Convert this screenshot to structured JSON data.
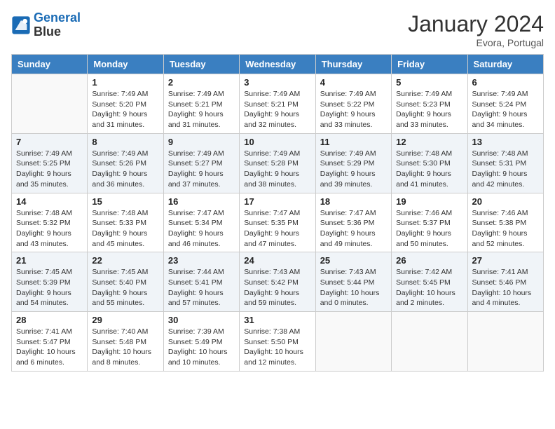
{
  "logo": {
    "line1": "General",
    "line2": "Blue"
  },
  "title": "January 2024",
  "location": "Evora, Portugal",
  "days_header": [
    "Sunday",
    "Monday",
    "Tuesday",
    "Wednesday",
    "Thursday",
    "Friday",
    "Saturday"
  ],
  "weeks": [
    [
      {
        "day": "",
        "info": ""
      },
      {
        "day": "1",
        "info": "Sunrise: 7:49 AM\nSunset: 5:20 PM\nDaylight: 9 hours and 31 minutes."
      },
      {
        "day": "2",
        "info": "Sunrise: 7:49 AM\nSunset: 5:21 PM\nDaylight: 9 hours and 31 minutes."
      },
      {
        "day": "3",
        "info": "Sunrise: 7:49 AM\nSunset: 5:21 PM\nDaylight: 9 hours and 32 minutes."
      },
      {
        "day": "4",
        "info": "Sunrise: 7:49 AM\nSunset: 5:22 PM\nDaylight: 9 hours and 33 minutes."
      },
      {
        "day": "5",
        "info": "Sunrise: 7:49 AM\nSunset: 5:23 PM\nDaylight: 9 hours and 33 minutes."
      },
      {
        "day": "6",
        "info": "Sunrise: 7:49 AM\nSunset: 5:24 PM\nDaylight: 9 hours and 34 minutes."
      }
    ],
    [
      {
        "day": "7",
        "info": "Sunrise: 7:49 AM\nSunset: 5:25 PM\nDaylight: 9 hours and 35 minutes."
      },
      {
        "day": "8",
        "info": "Sunrise: 7:49 AM\nSunset: 5:26 PM\nDaylight: 9 hours and 36 minutes."
      },
      {
        "day": "9",
        "info": "Sunrise: 7:49 AM\nSunset: 5:27 PM\nDaylight: 9 hours and 37 minutes."
      },
      {
        "day": "10",
        "info": "Sunrise: 7:49 AM\nSunset: 5:28 PM\nDaylight: 9 hours and 38 minutes."
      },
      {
        "day": "11",
        "info": "Sunrise: 7:49 AM\nSunset: 5:29 PM\nDaylight: 9 hours and 39 minutes."
      },
      {
        "day": "12",
        "info": "Sunrise: 7:48 AM\nSunset: 5:30 PM\nDaylight: 9 hours and 41 minutes."
      },
      {
        "day": "13",
        "info": "Sunrise: 7:48 AM\nSunset: 5:31 PM\nDaylight: 9 hours and 42 minutes."
      }
    ],
    [
      {
        "day": "14",
        "info": "Sunrise: 7:48 AM\nSunset: 5:32 PM\nDaylight: 9 hours and 43 minutes."
      },
      {
        "day": "15",
        "info": "Sunrise: 7:48 AM\nSunset: 5:33 PM\nDaylight: 9 hours and 45 minutes."
      },
      {
        "day": "16",
        "info": "Sunrise: 7:47 AM\nSunset: 5:34 PM\nDaylight: 9 hours and 46 minutes."
      },
      {
        "day": "17",
        "info": "Sunrise: 7:47 AM\nSunset: 5:35 PM\nDaylight: 9 hours and 47 minutes."
      },
      {
        "day": "18",
        "info": "Sunrise: 7:47 AM\nSunset: 5:36 PM\nDaylight: 9 hours and 49 minutes."
      },
      {
        "day": "19",
        "info": "Sunrise: 7:46 AM\nSunset: 5:37 PM\nDaylight: 9 hours and 50 minutes."
      },
      {
        "day": "20",
        "info": "Sunrise: 7:46 AM\nSunset: 5:38 PM\nDaylight: 9 hours and 52 minutes."
      }
    ],
    [
      {
        "day": "21",
        "info": "Sunrise: 7:45 AM\nSunset: 5:39 PM\nDaylight: 9 hours and 54 minutes."
      },
      {
        "day": "22",
        "info": "Sunrise: 7:45 AM\nSunset: 5:40 PM\nDaylight: 9 hours and 55 minutes."
      },
      {
        "day": "23",
        "info": "Sunrise: 7:44 AM\nSunset: 5:41 PM\nDaylight: 9 hours and 57 minutes."
      },
      {
        "day": "24",
        "info": "Sunrise: 7:43 AM\nSunset: 5:42 PM\nDaylight: 9 hours and 59 minutes."
      },
      {
        "day": "25",
        "info": "Sunrise: 7:43 AM\nSunset: 5:44 PM\nDaylight: 10 hours and 0 minutes."
      },
      {
        "day": "26",
        "info": "Sunrise: 7:42 AM\nSunset: 5:45 PM\nDaylight: 10 hours and 2 minutes."
      },
      {
        "day": "27",
        "info": "Sunrise: 7:41 AM\nSunset: 5:46 PM\nDaylight: 10 hours and 4 minutes."
      }
    ],
    [
      {
        "day": "28",
        "info": "Sunrise: 7:41 AM\nSunset: 5:47 PM\nDaylight: 10 hours and 6 minutes."
      },
      {
        "day": "29",
        "info": "Sunrise: 7:40 AM\nSunset: 5:48 PM\nDaylight: 10 hours and 8 minutes."
      },
      {
        "day": "30",
        "info": "Sunrise: 7:39 AM\nSunset: 5:49 PM\nDaylight: 10 hours and 10 minutes."
      },
      {
        "day": "31",
        "info": "Sunrise: 7:38 AM\nSunset: 5:50 PM\nDaylight: 10 hours and 12 minutes."
      },
      {
        "day": "",
        "info": ""
      },
      {
        "day": "",
        "info": ""
      },
      {
        "day": "",
        "info": ""
      }
    ]
  ]
}
